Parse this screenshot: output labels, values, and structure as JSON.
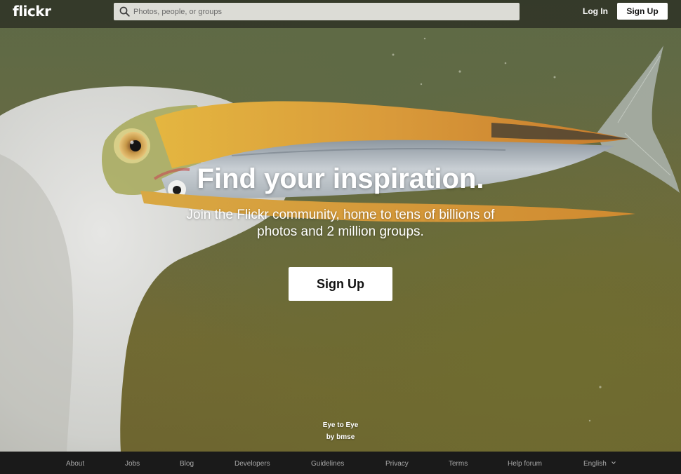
{
  "header": {
    "logo": "flickr",
    "search_placeholder": "Photos, people, or groups",
    "search_value": "",
    "login_label": "Log In",
    "signup_label": "Sign Up",
    "icons": [
      "search-icon"
    ]
  },
  "hero": {
    "title": "Find your inspiration.",
    "subtitle": "Join the Flickr community, home to tens of billions of photos and 2 million groups.",
    "signup_label": "Sign Up",
    "photo_title": "Eye to Eye",
    "photo_credit": "by bmse"
  },
  "footer": {
    "links": [
      "About",
      "Jobs",
      "Blog",
      "Developers",
      "Guidelines",
      "Privacy",
      "Terms",
      "Help forum"
    ],
    "language": "English",
    "icons": [
      "chevron-down-icon"
    ]
  },
  "colors": {
    "topbar": "#141414",
    "footer": "#1a1a1a",
    "button_bg": "#ffffff",
    "footer_text": "#a8a8a8"
  }
}
